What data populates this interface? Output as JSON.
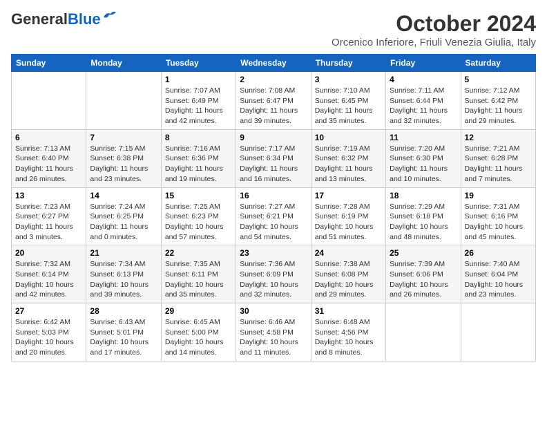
{
  "logo": {
    "line1": "General",
    "line2": "Blue"
  },
  "header": {
    "month": "October 2024",
    "location": "Orcenico Inferiore, Friuli Venezia Giulia, Italy"
  },
  "weekdays": [
    "Sunday",
    "Monday",
    "Tuesday",
    "Wednesday",
    "Thursday",
    "Friday",
    "Saturday"
  ],
  "weeks": [
    [
      {
        "day": "",
        "info": ""
      },
      {
        "day": "",
        "info": ""
      },
      {
        "day": "1",
        "info": "Sunrise: 7:07 AM\nSunset: 6:49 PM\nDaylight: 11 hours and 42 minutes."
      },
      {
        "day": "2",
        "info": "Sunrise: 7:08 AM\nSunset: 6:47 PM\nDaylight: 11 hours and 39 minutes."
      },
      {
        "day": "3",
        "info": "Sunrise: 7:10 AM\nSunset: 6:45 PM\nDaylight: 11 hours and 35 minutes."
      },
      {
        "day": "4",
        "info": "Sunrise: 7:11 AM\nSunset: 6:44 PM\nDaylight: 11 hours and 32 minutes."
      },
      {
        "day": "5",
        "info": "Sunrise: 7:12 AM\nSunset: 6:42 PM\nDaylight: 11 hours and 29 minutes."
      }
    ],
    [
      {
        "day": "6",
        "info": "Sunrise: 7:13 AM\nSunset: 6:40 PM\nDaylight: 11 hours and 26 minutes."
      },
      {
        "day": "7",
        "info": "Sunrise: 7:15 AM\nSunset: 6:38 PM\nDaylight: 11 hours and 23 minutes."
      },
      {
        "day": "8",
        "info": "Sunrise: 7:16 AM\nSunset: 6:36 PM\nDaylight: 11 hours and 19 minutes."
      },
      {
        "day": "9",
        "info": "Sunrise: 7:17 AM\nSunset: 6:34 PM\nDaylight: 11 hours and 16 minutes."
      },
      {
        "day": "10",
        "info": "Sunrise: 7:19 AM\nSunset: 6:32 PM\nDaylight: 11 hours and 13 minutes."
      },
      {
        "day": "11",
        "info": "Sunrise: 7:20 AM\nSunset: 6:30 PM\nDaylight: 11 hours and 10 minutes."
      },
      {
        "day": "12",
        "info": "Sunrise: 7:21 AM\nSunset: 6:28 PM\nDaylight: 11 hours and 7 minutes."
      }
    ],
    [
      {
        "day": "13",
        "info": "Sunrise: 7:23 AM\nSunset: 6:27 PM\nDaylight: 11 hours and 3 minutes."
      },
      {
        "day": "14",
        "info": "Sunrise: 7:24 AM\nSunset: 6:25 PM\nDaylight: 11 hours and 0 minutes."
      },
      {
        "day": "15",
        "info": "Sunrise: 7:25 AM\nSunset: 6:23 PM\nDaylight: 10 hours and 57 minutes."
      },
      {
        "day": "16",
        "info": "Sunrise: 7:27 AM\nSunset: 6:21 PM\nDaylight: 10 hours and 54 minutes."
      },
      {
        "day": "17",
        "info": "Sunrise: 7:28 AM\nSunset: 6:19 PM\nDaylight: 10 hours and 51 minutes."
      },
      {
        "day": "18",
        "info": "Sunrise: 7:29 AM\nSunset: 6:18 PM\nDaylight: 10 hours and 48 minutes."
      },
      {
        "day": "19",
        "info": "Sunrise: 7:31 AM\nSunset: 6:16 PM\nDaylight: 10 hours and 45 minutes."
      }
    ],
    [
      {
        "day": "20",
        "info": "Sunrise: 7:32 AM\nSunset: 6:14 PM\nDaylight: 10 hours and 42 minutes."
      },
      {
        "day": "21",
        "info": "Sunrise: 7:34 AM\nSunset: 6:13 PM\nDaylight: 10 hours and 39 minutes."
      },
      {
        "day": "22",
        "info": "Sunrise: 7:35 AM\nSunset: 6:11 PM\nDaylight: 10 hours and 35 minutes."
      },
      {
        "day": "23",
        "info": "Sunrise: 7:36 AM\nSunset: 6:09 PM\nDaylight: 10 hours and 32 minutes."
      },
      {
        "day": "24",
        "info": "Sunrise: 7:38 AM\nSunset: 6:08 PM\nDaylight: 10 hours and 29 minutes."
      },
      {
        "day": "25",
        "info": "Sunrise: 7:39 AM\nSunset: 6:06 PM\nDaylight: 10 hours and 26 minutes."
      },
      {
        "day": "26",
        "info": "Sunrise: 7:40 AM\nSunset: 6:04 PM\nDaylight: 10 hours and 23 minutes."
      }
    ],
    [
      {
        "day": "27",
        "info": "Sunrise: 6:42 AM\nSunset: 5:03 PM\nDaylight: 10 hours and 20 minutes."
      },
      {
        "day": "28",
        "info": "Sunrise: 6:43 AM\nSunset: 5:01 PM\nDaylight: 10 hours and 17 minutes."
      },
      {
        "day": "29",
        "info": "Sunrise: 6:45 AM\nSunset: 5:00 PM\nDaylight: 10 hours and 14 minutes."
      },
      {
        "day": "30",
        "info": "Sunrise: 6:46 AM\nSunset: 4:58 PM\nDaylight: 10 hours and 11 minutes."
      },
      {
        "day": "31",
        "info": "Sunrise: 6:48 AM\nSunset: 4:56 PM\nDaylight: 10 hours and 8 minutes."
      },
      {
        "day": "",
        "info": ""
      },
      {
        "day": "",
        "info": ""
      }
    ]
  ]
}
